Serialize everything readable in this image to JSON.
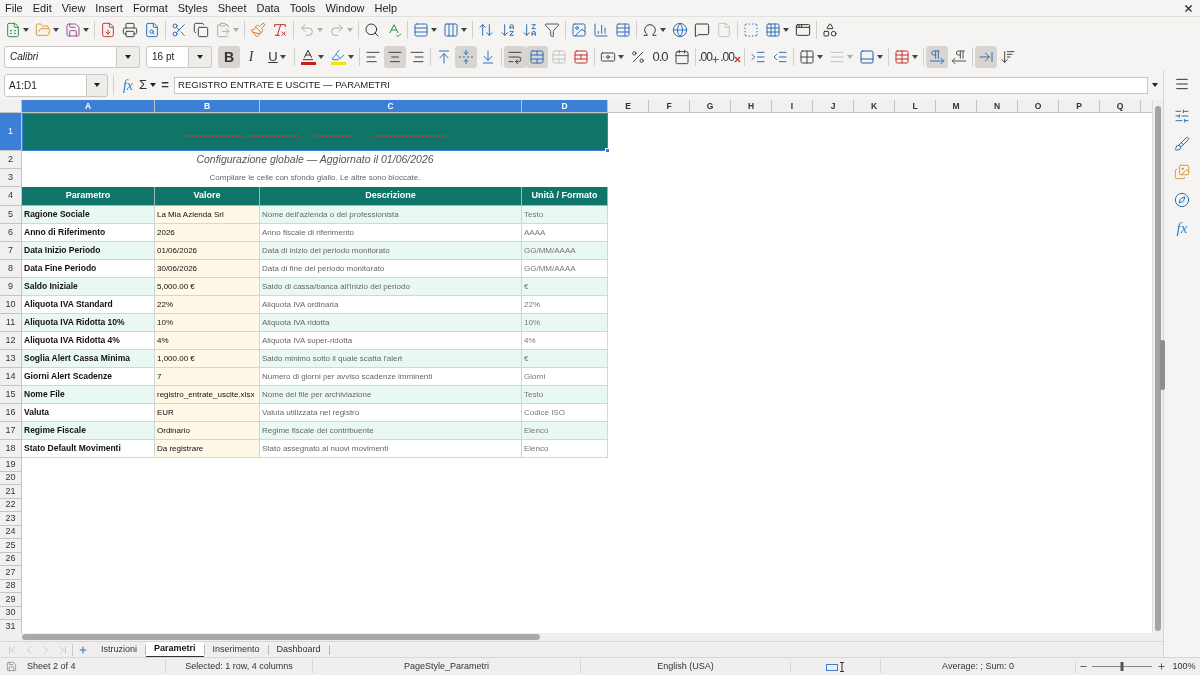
{
  "menu_bar": {
    "items": [
      "File",
      "Edit",
      "View",
      "Insert",
      "Format",
      "Styles",
      "Sheet",
      "Data",
      "Tools",
      "Window",
      "Help"
    ]
  },
  "standard_toolbar": [
    [
      {
        "kind": "new",
        "disabled": false
      },
      {
        "kind": "open",
        "disabled": false
      },
      {
        "kind": "save",
        "disabled": false
      }
    ],
    [
      {
        "kind": "export_pdf",
        "disabled": false
      },
      {
        "kind": "print",
        "disabled": false
      },
      {
        "kind": "print_preview",
        "disabled": false
      }
    ],
    [
      {
        "kind": "cut",
        "disabled": false
      },
      {
        "kind": "copy",
        "disabled": false
      },
      {
        "kind": "paste",
        "disabled": true
      }
    ],
    [
      {
        "kind": "clone",
        "disabled": false
      },
      {
        "kind": "clear_formatting",
        "disabled": false
      }
    ],
    [
      {
        "kind": "undo",
        "disabled": true
      },
      {
        "kind": "redo",
        "disabled": true
      }
    ],
    [
      {
        "kind": "find_replace",
        "disabled": false
      },
      {
        "kind": "spelling",
        "disabled": false
      }
    ],
    [
      {
        "kind": "row",
        "disabled": false
      },
      {
        "kind": "column",
        "disabled": false
      }
    ],
    [
      {
        "kind": "sort",
        "disabled": false
      },
      {
        "kind": "sort_asc",
        "disabled": false
      },
      {
        "kind": "sort_desc",
        "disabled": false
      },
      {
        "kind": "autofilter",
        "disabled": false
      }
    ],
    [
      {
        "kind": "image",
        "disabled": false
      },
      {
        "kind": "chart",
        "disabled": false
      },
      {
        "kind": "pivot",
        "disabled": false
      }
    ],
    [
      {
        "kind": "special_char",
        "disabled": false
      },
      {
        "kind": "hyperlink",
        "disabled": false
      },
      {
        "kind": "comment",
        "disabled": false
      },
      {
        "kind": "header_footer",
        "disabled": true
      }
    ],
    [
      {
        "kind": "print_area",
        "disabled": false
      },
      {
        "kind": "freeze",
        "disabled": false
      },
      {
        "kind": "split",
        "disabled": false
      }
    ],
    [
      {
        "kind": "draw",
        "disabled": false
      }
    ]
  ],
  "format_toolbar": {
    "font_name": "Calibri",
    "font_size": "16 pt",
    "groups": [
      [
        {
          "kind": "bold",
          "label": "B",
          "pressed": true,
          "disabled": false
        },
        {
          "kind": "italic",
          "label": "I",
          "pressed": false,
          "disabled": false
        },
        {
          "kind": "underline",
          "label": "U",
          "pressed": false,
          "disabled": false
        }
      ],
      [
        {
          "kind": "font_color",
          "pressed": false,
          "disabled": false
        },
        {
          "kind": "highlight",
          "pressed": false,
          "disabled": false
        }
      ],
      [
        {
          "kind": "align_left",
          "pressed": false,
          "disabled": false
        },
        {
          "kind": "align_center",
          "pressed": true,
          "disabled": false
        },
        {
          "kind": "align_right",
          "pressed": false,
          "disabled": false
        }
      ],
      [
        {
          "kind": "align_top",
          "pressed": false,
          "disabled": false
        },
        {
          "kind": "align_middle",
          "pressed": true,
          "disabled": false
        },
        {
          "kind": "align_bottom",
          "pressed": false,
          "disabled": false
        }
      ],
      [
        {
          "kind": "wrap",
          "pressed": true,
          "disabled": false
        },
        {
          "kind": "merge_center",
          "pressed": true,
          "disabled": false
        },
        {
          "kind": "merge",
          "pressed": false,
          "disabled": true
        },
        {
          "kind": "unmerge",
          "pressed": false,
          "disabled": false
        }
      ],
      [
        {
          "kind": "currency",
          "pressed": false,
          "disabled": false
        },
        {
          "kind": "percent",
          "pressed": false,
          "disabled": false
        },
        {
          "kind": "number",
          "label": "0.0",
          "pressed": false,
          "disabled": false
        },
        {
          "kind": "date",
          "pressed": false,
          "disabled": false
        }
      ],
      [
        {
          "kind": "add_decimal",
          "label": ".00",
          "pressed": false,
          "disabled": false
        },
        {
          "kind": "delete_decimal",
          "label": ".00",
          "pressed": false,
          "disabled": false
        }
      ],
      [
        {
          "kind": "indent_increase",
          "pressed": false,
          "disabled": false
        },
        {
          "kind": "indent_decrease",
          "pressed": false,
          "disabled": false
        }
      ],
      [
        {
          "kind": "borders",
          "pressed": false,
          "disabled": false
        },
        {
          "kind": "border_style",
          "pressed": false,
          "disabled": true
        },
        {
          "kind": "border_color",
          "pressed": false,
          "disabled": false
        }
      ],
      [
        {
          "kind": "conditional",
          "pressed": false,
          "disabled": false
        }
      ],
      [
        {
          "kind": "ltr",
          "pressed": true,
          "disabled": false
        },
        {
          "kind": "rtl",
          "pressed": false,
          "disabled": false
        }
      ],
      [
        {
          "kind": "text_lr",
          "pressed": true,
          "disabled": false
        },
        {
          "kind": "text_tb",
          "pressed": false,
          "disabled": false
        }
      ]
    ]
  },
  "formula_bar": {
    "name_box": "A1:D1",
    "function_wizard": "fx",
    "sum": "Σ",
    "equals": "=",
    "content": "REGISTRO ENTRATE E USCITE — PARAMETRI"
  },
  "sidebar": [
    {
      "kind": "menu"
    },
    {
      "kind": "properties"
    },
    {
      "kind": "styles"
    },
    {
      "kind": "gallery"
    },
    {
      "kind": "navigator"
    },
    {
      "kind": "functions",
      "label": "fx"
    }
  ],
  "sheet": {
    "columns": [
      {
        "label": "A",
        "selected": true
      },
      {
        "label": "B",
        "selected": true
      },
      {
        "label": "C",
        "selected": true
      },
      {
        "label": "D",
        "selected": true
      },
      {
        "label": "E",
        "selected": false
      },
      {
        "label": "F",
        "selected": false
      },
      {
        "label": "G",
        "selected": false
      },
      {
        "label": "H",
        "selected": false
      },
      {
        "label": "I",
        "selected": false
      },
      {
        "label": "J",
        "selected": false
      },
      {
        "label": "K",
        "selected": false
      },
      {
        "label": "L",
        "selected": false
      },
      {
        "label": "M",
        "selected": false
      },
      {
        "label": "N",
        "selected": false
      },
      {
        "label": "O",
        "selected": false
      },
      {
        "label": "P",
        "selected": false
      },
      {
        "label": "Q",
        "selected": false
      }
    ],
    "rows": [
      {
        "label": "1",
        "selected": true
      },
      {
        "label": "2",
        "selected": false
      },
      {
        "label": "3",
        "selected": false
      },
      {
        "label": "4",
        "selected": false
      },
      {
        "label": "5",
        "selected": false
      },
      {
        "label": "6",
        "selected": false
      },
      {
        "label": "7",
        "selected": false
      },
      {
        "label": "8",
        "selected": false
      },
      {
        "label": "9",
        "selected": false
      },
      {
        "label": "10",
        "selected": false
      },
      {
        "label": "11",
        "selected": false
      },
      {
        "label": "12",
        "selected": false
      },
      {
        "label": "13",
        "selected": false
      },
      {
        "label": "14",
        "selected": false
      },
      {
        "label": "15",
        "selected": false
      },
      {
        "label": "16",
        "selected": false
      },
      {
        "label": "17",
        "selected": false
      },
      {
        "label": "18",
        "selected": false
      },
      {
        "label": "19",
        "selected": false
      },
      {
        "label": "20",
        "selected": false
      },
      {
        "label": "21",
        "selected": false
      },
      {
        "label": "22",
        "selected": false
      },
      {
        "label": "23",
        "selected": false
      },
      {
        "label": "24",
        "selected": false
      },
      {
        "label": "25",
        "selected": false
      },
      {
        "label": "26",
        "selected": false
      },
      {
        "label": "27",
        "selected": false
      },
      {
        "label": "28",
        "selected": false
      },
      {
        "label": "29",
        "selected": false
      },
      {
        "label": "30",
        "selected": false
      },
      {
        "label": "31",
        "selected": false
      }
    ],
    "subtitle": "Configurazione globale — Aggiornato il 01/06/2026",
    "instructions": "Compilare le celle con sfondo giallo. Le altre sono bloccate.",
    "table": {
      "columns": [
        "Parametro",
        "Valore",
        "Descrizione",
        "Unità / Formato"
      ],
      "rows": [
        {
          "parameter": "Ragione Sociale",
          "value": "La Mia Azienda Srl",
          "description": "Nome dell'azienda o del professionista",
          "unit": "Testo"
        },
        {
          "parameter": "Anno di Riferimento",
          "value": "2026",
          "description": "Anno fiscale di riferimento",
          "unit": "AAAA"
        },
        {
          "parameter": "Data Inizio Periodo",
          "value": "01/06/2026",
          "description": "Data di inizio del periodo monitorato",
          "unit": "GG/MM/AAAA"
        },
        {
          "parameter": "Data Fine Periodo",
          "value": "30/06/2026",
          "description": "Data di fine del periodo monitorato",
          "unit": "GG/MM/AAAA"
        },
        {
          "parameter": "Saldo Iniziale",
          "value": "5,000.00 €",
          "description": "Saldo di cassa/banca all'inizio del periodo",
          "unit": "€"
        },
        {
          "parameter": "Aliquota IVA Standard",
          "value": "22%",
          "description": "Aliquota IVA ordinaria",
          "unit": "22%"
        },
        {
          "parameter": "Aliquota IVA Ridotta 10%",
          "value": "10%",
          "description": "Aliquota IVA ridotta",
          "unit": "10%"
        },
        {
          "parameter": "Aliquota IVA Ridotta 4%",
          "value": "4%",
          "description": "Aliquota IVA super-ridotta",
          "unit": "4%"
        },
        {
          "parameter": "Soglia Alert Cassa Minima",
          "value": "1,000.00 €",
          "description": "Saldo minimo sotto il quale scatta l'alert",
          "unit": "€"
        },
        {
          "parameter": "Giorni Alert Scadenze",
          "value": "7",
          "description": "Numero di giorni per avviso scadenze imminenti",
          "unit": "Giorni"
        },
        {
          "parameter": "Nome File",
          "value": "registro_entrate_uscite.xlsx",
          "description": "Nome del file per archiviazione",
          "unit": "Testo"
        },
        {
          "parameter": "Valuta",
          "value": "EUR",
          "description": "Valuta utilizzata nel registro",
          "unit": "Codice ISO"
        },
        {
          "parameter": "Regime Fiscale",
          "value": "Ordinario",
          "description": "Regime fiscale del contribuente",
          "unit": "Elenco"
        },
        {
          "parameter": "Stato Default Movimenti",
          "value": "Da registrare",
          "description": "Stato assegnato ai nuovi movimenti",
          "unit": "Elenco"
        }
      ]
    }
  },
  "sheet_tabs": [
    {
      "label": "Istruzioni",
      "selected": false
    },
    {
      "label": "Parametri",
      "selected": true
    },
    {
      "label": "Inserimento",
      "selected": false
    },
    {
      "label": "Dashboard",
      "selected": false
    }
  ],
  "status_bar": {
    "sheet": "Sheet 2 of 4",
    "selection": "Selected: 1 row, 4 columns",
    "page_style": "PageStyle_Parametri",
    "language": "English (USA)",
    "summary": "Average: ; Sum: 0",
    "zoom": {
      "level": 0.5,
      "reading": "100%"
    }
  }
}
